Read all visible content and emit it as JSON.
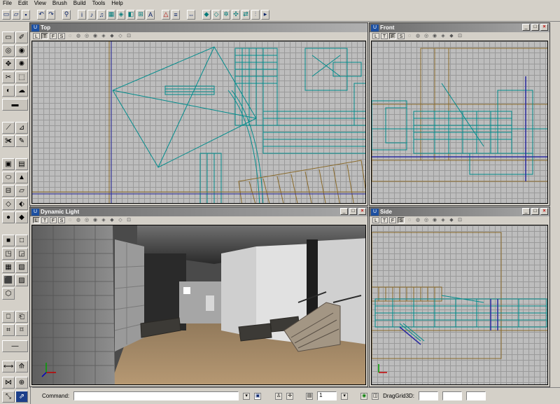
{
  "menu": [
    "File",
    "Edit",
    "View",
    "Brush",
    "Build",
    "Tools",
    "Help"
  ],
  "toolbar_icons": [
    "new-icon",
    "open-icon",
    "save-icon",
    "undo-icon",
    "redo-icon",
    "find-icon",
    "actor-browser-icon",
    "sound-browser-icon",
    "music-browser-icon",
    "texture-browser-icon",
    "mesh-browser-icon",
    "prefab-browser-icon",
    "font-browser-icon",
    "group-browser-icon",
    "unreal-script-icon",
    "rebuild-geometry-icon",
    "rebuild-lighting-icon",
    "rebuild-paths-icon",
    "rebuild-all-icon",
    "play-level-icon"
  ],
  "viewports": {
    "top": {
      "title": "Top"
    },
    "front": {
      "title": "Front"
    },
    "dynamic": {
      "title": "Dynamic Light"
    },
    "side": {
      "title": "Side"
    }
  },
  "viewport_toolbar": [
    "L",
    "T",
    "F",
    "S"
  ],
  "statusbar": {
    "command_label": "Command:",
    "grid_value": "1",
    "drag_label": "DragGrid3D:"
  },
  "colors": {
    "wire_teal": "#008c8c",
    "wire_brown": "#8a6a2a",
    "wire_blue": "#2a2aa0",
    "grid_bg": "#bdbdbd"
  }
}
